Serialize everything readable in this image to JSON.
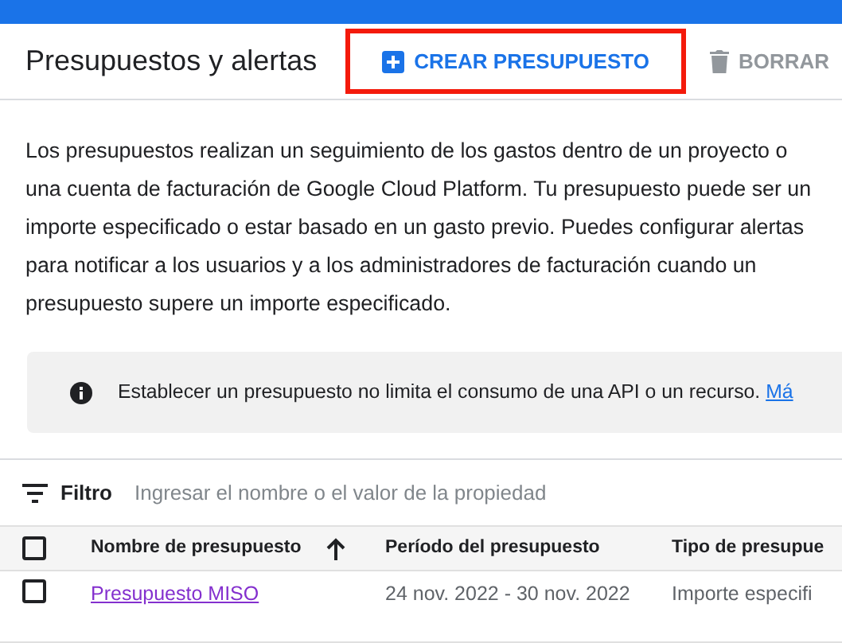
{
  "header": {
    "title": "Presupuestos y alertas",
    "actions": [
      {
        "label": "CREAR PRESUPUESTO",
        "kind": "create",
        "disabled": false,
        "highlighted": true
      },
      {
        "label": "BORRAR",
        "kind": "delete",
        "disabled": true,
        "highlighted": false
      }
    ]
  },
  "description": "Los presupuestos realizan un seguimiento de los gastos dentro de un proyecto o una cuenta de facturación de Google Cloud Platform. Tu presupuesto puede ser un importe especificado o estar basado en un gasto previo. Puedes configurar alertas para notificar a los usuarios y a los administradores de facturación cuando un presupuesto supere un importe especificado.",
  "info": {
    "text": "Establecer un presupuesto no limita el consumo de una API o un recurso.",
    "link": "Má"
  },
  "filter": {
    "label": "Filtro",
    "placeholder": "Ingresar el nombre o el valor de la propiedad"
  },
  "table": {
    "select_all_checked": false,
    "columns": [
      {
        "label": "Nombre de presupuesto",
        "sorted": true
      },
      {
        "label": "Período del presupuesto",
        "sorted": false
      },
      {
        "label": "Tipo de presupue",
        "sorted": false
      }
    ],
    "rows": [
      {
        "checked": false,
        "cells": [
          "Presupuesto MISO",
          "24 nov. 2022 - 30 nov. 2022",
          "Importe especifi"
        ]
      }
    ]
  }
}
